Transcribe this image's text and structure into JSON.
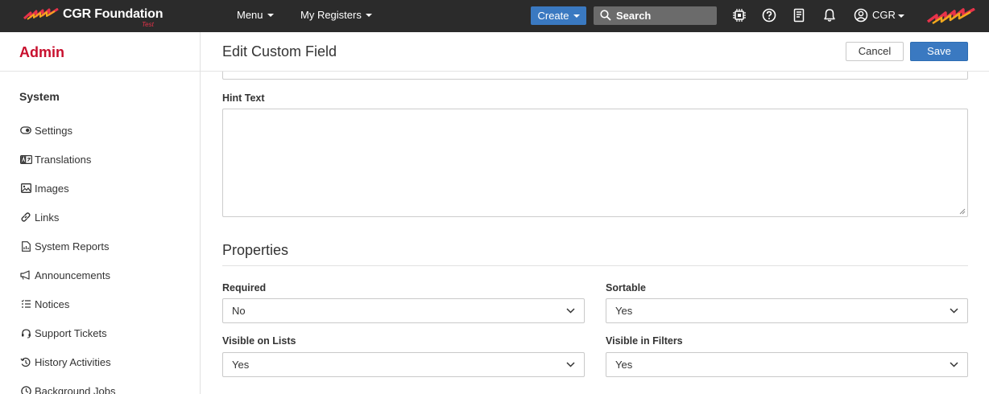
{
  "brand": {
    "name": "CGR Foundation",
    "environment": "Test",
    "accent": "#e8334a"
  },
  "topbar": {
    "menu_label": "Menu",
    "registers_label": "My Registers",
    "create_label": "Create",
    "search_label": "Search",
    "icons": [
      "chip-icon",
      "help-icon",
      "book-icon",
      "bell-icon"
    ],
    "user_label": "CGR"
  },
  "sidebar": {
    "title": "Admin",
    "section": "System",
    "items": [
      {
        "label": "Settings",
        "icon": "toggle-icon"
      },
      {
        "label": "Translations",
        "icon": "translate-icon"
      },
      {
        "label": "Images",
        "icon": "image-icon"
      },
      {
        "label": "Links",
        "icon": "link-icon"
      },
      {
        "label": "System Reports",
        "icon": "report-icon"
      },
      {
        "label": "Announcements",
        "icon": "megaphone-icon"
      },
      {
        "label": "Notices",
        "icon": "list-icon"
      },
      {
        "label": "Support Tickets",
        "icon": "headset-icon"
      },
      {
        "label": "History Activities",
        "icon": "history-icon"
      },
      {
        "label": "Background Jobs",
        "icon": "clock-icon"
      }
    ]
  },
  "main": {
    "title": "Edit Custom Field",
    "cancel_label": "Cancel",
    "save_label": "Save",
    "hint_text_label": "Hint Text",
    "hint_text_value": "",
    "properties_title": "Properties",
    "fields": {
      "required": {
        "label": "Required",
        "value": "No"
      },
      "sortable": {
        "label": "Sortable",
        "value": "Yes"
      },
      "visible_on_lists": {
        "label": "Visible on Lists",
        "value": "Yes"
      },
      "visible_in_filters": {
        "label": "Visible in Filters",
        "value": "Yes"
      }
    }
  },
  "colors": {
    "primary": "#3a79c1",
    "admin_title": "#c8102e",
    "navbar": "#2b2b2b"
  }
}
